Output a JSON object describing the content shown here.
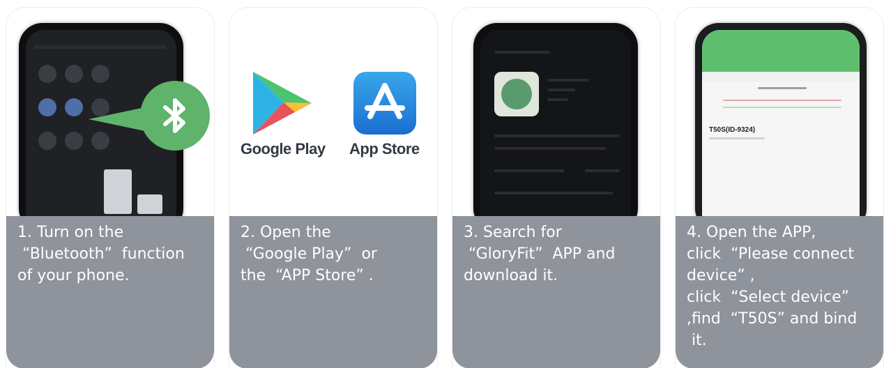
{
  "steps": [
    {
      "caption_lines": [
        "1. Turn on the",
        " “Bluetooth”  function",
        "of your phone."
      ]
    },
    {
      "caption_lines": [
        "2. Open the",
        " “Google Play”  or",
        "the  “APP Store” ."
      ],
      "stores": {
        "google_play": "Google Play",
        "app_store": "App Store"
      }
    },
    {
      "caption_lines": [
        "3. Search for",
        " “GloryFit”  APP and",
        "download it."
      ]
    },
    {
      "caption_lines": [
        "4. Open the APP,",
        "click  “Please connect",
        "device” ,",
        "click  “Select device”",
        ",find  “T50S” and bind",
        " it."
      ],
      "device_name": "T50S(ID-9324)"
    }
  ],
  "colors": {
    "caption_bg": "#8e939c",
    "bluetooth_green": "#5fb36b",
    "app_green": "#5fbf6e"
  },
  "icons": [
    "bluetooth-icon",
    "google-play-icon",
    "app-store-icon",
    "gloryfit-app-icon"
  ]
}
